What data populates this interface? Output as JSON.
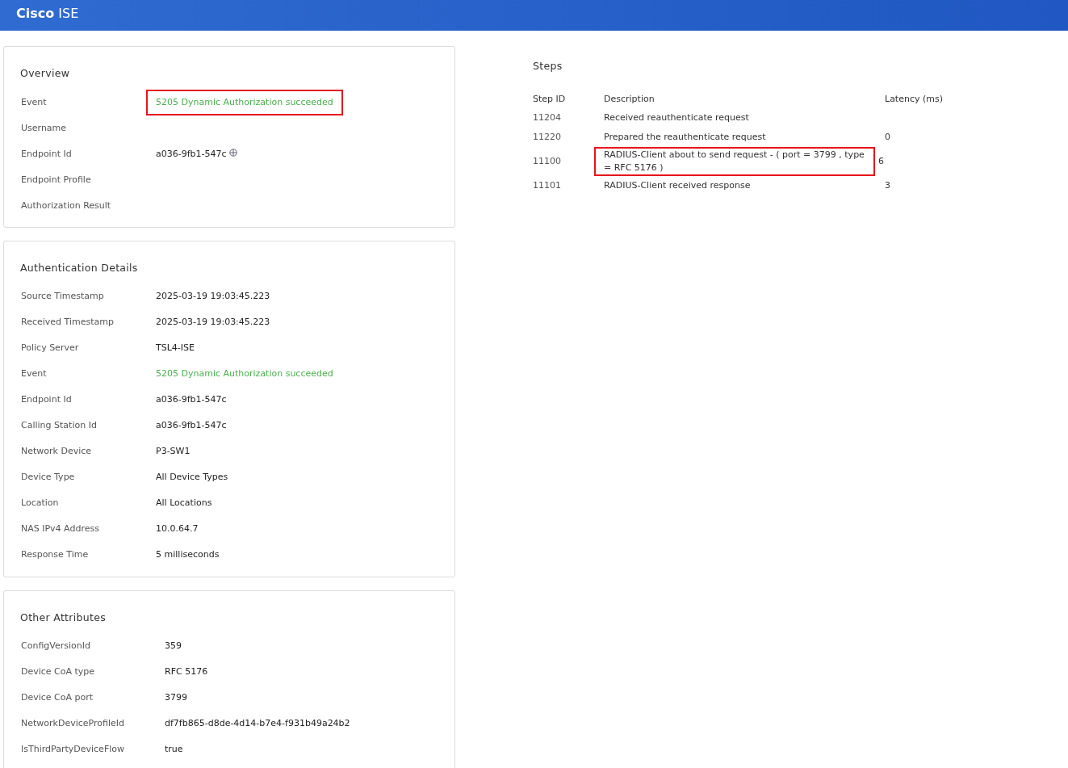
{
  "header": {
    "brand": "Cisco",
    "product": "ISE"
  },
  "overview": {
    "title": "Overview",
    "rows": [
      {
        "label": "Event",
        "value": "5205 Dynamic Authorization succeeded",
        "color": "#4caf50",
        "highlighted": true
      },
      {
        "label": "Username"
      },
      {
        "label": "Endpoint Id",
        "value": "a036-9fb1-547c",
        "locate_icon": true
      },
      {
        "label": "Endpoint Profile"
      },
      {
        "label": "Authorization Result"
      }
    ]
  },
  "authentication_details": {
    "title": "Authentication Details",
    "rows": [
      {
        "label": "Source Timestamp",
        "value": "2025-03-19 19:03:45.223"
      },
      {
        "label": "Received Timestamp",
        "value": "2025-03-19 19:03:45.223"
      },
      {
        "label": "Policy Server",
        "value": "TSL4-ISE"
      },
      {
        "label": "Event",
        "value": "5205 Dynamic Authorization succeeded",
        "color": "#4caf50"
      },
      {
        "label": "Endpoint Id",
        "value": "a036-9fb1-547c"
      },
      {
        "label": "Calling Station Id",
        "value": "a036-9fb1-547c"
      },
      {
        "label": "Network Device",
        "value": "P3-SW1"
      },
      {
        "label": "Device Type",
        "value": "All Device Types"
      },
      {
        "label": "Location",
        "value": "All Locations"
      },
      {
        "label": "NAS IPv4 Address",
        "value": "10.0.64.7"
      },
      {
        "label": "Response Time",
        "value": "5 milliseconds"
      }
    ]
  },
  "other_attributes": {
    "title": "Other Attributes",
    "rows": [
      {
        "label": "ConfigVersionId",
        "value": "359"
      },
      {
        "label": "Device CoA type",
        "value": "RFC 5176"
      },
      {
        "label": "Device CoA port",
        "value": "3799"
      },
      {
        "label": "NetworkDeviceProfileId",
        "value": "df7fb865-d8de-4d14-b7e4-f931b49a24b2"
      },
      {
        "label": "IsThirdPartyDeviceFlow",
        "value": "true"
      }
    ]
  },
  "steps": {
    "title": "Steps",
    "columns": [
      "Step ID",
      "Description",
      "Latency (ms)"
    ],
    "rows": [
      {
        "step_id": "11204",
        "description": "Received reauthenticate request"
      },
      {
        "step_id": "11220",
        "description": "Prepared the reauthenticate request",
        "latency": "0"
      },
      {
        "step_id": "11100",
        "description": "RADIUS-Client about to send request - ( port = 3799 , type = RFC 5176 )",
        "latency": "6",
        "highlighted": true
      },
      {
        "step_id": "11101",
        "description": "RADIUS-Client received response",
        "latency": "3"
      }
    ]
  }
}
